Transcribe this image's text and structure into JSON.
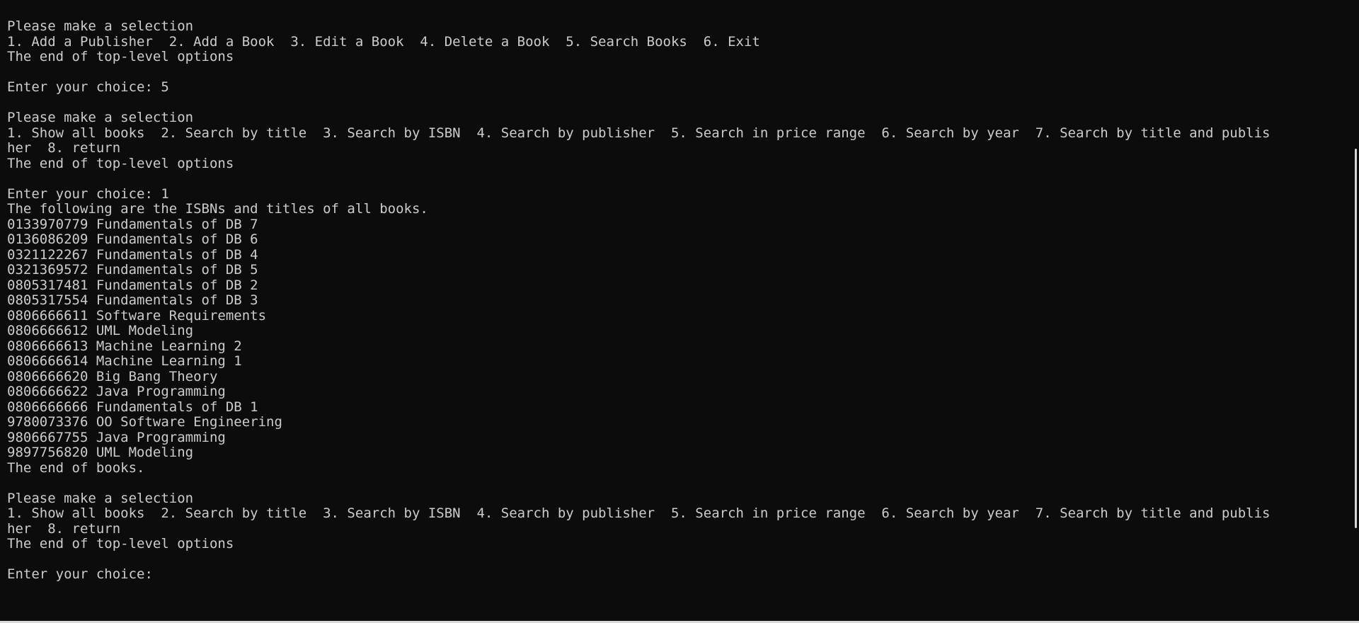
{
  "terminal": {
    "lines": [
      "Please make a selection",
      "1. Add a Publisher  2. Add a Book  3. Edit a Book  4. Delete a Book  5. Search Books  6. Exit",
      "The end of top-level options",
      "",
      "Enter your choice: 5",
      "",
      "Please make a selection",
      "1. Show all books  2. Search by title  3. Search by ISBN  4. Search by publisher  5. Search in price range  6. Search by year  7. Search by title and publis",
      "her  8. return",
      "The end of top-level options",
      "",
      "Enter your choice: 1",
      "The following are the ISBNs and titles of all books.",
      "0133970779 Fundamentals of DB 7",
      "0136086209 Fundamentals of DB 6",
      "0321122267 Fundamentals of DB 4",
      "0321369572 Fundamentals of DB 5",
      "0805317481 Fundamentals of DB 2",
      "0805317554 Fundamentals of DB 3",
      "0806666611 Software Requirements",
      "0806666612 UML Modeling",
      "0806666613 Machine Learning 2",
      "0806666614 Machine Learning 1",
      "0806666620 Big Bang Theory",
      "0806666622 Java Programming",
      "0806666666 Fundamentals of DB 1",
      "9780073376 OO Software Engineering",
      "9806667755 Java Programming",
      "9897756820 UML Modeling",
      "The end of books.",
      "",
      "Please make a selection",
      "1. Show all books  2. Search by title  3. Search by ISBN  4. Search by publisher  5. Search in price range  6. Search by year  7. Search by title and publis",
      "her  8. return",
      "The end of top-level options",
      "",
      "Enter your choice: "
    ]
  },
  "colors": {
    "background": "#0c0c0c",
    "text": "#cccccc",
    "scrollbar_thumb": "#d6d6d6"
  }
}
